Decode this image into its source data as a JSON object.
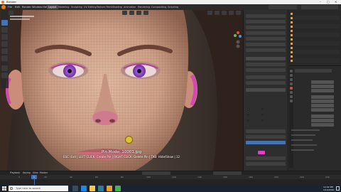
{
  "window": {
    "title": "Blender"
  },
  "menu": {
    "items": [
      "File",
      "Edit",
      "Render",
      "Window",
      "Help"
    ],
    "workspaces": [
      "Layout",
      "Modeling",
      "Sculpting",
      "UV Editing",
      "Texture Paint",
      "Shading",
      "Animation",
      "Rendering",
      "Compositing",
      "Scripting"
    ],
    "active_workspace": "Layout"
  },
  "viewport": {
    "mode_title": "Pin Mode: 10001.jpg",
    "hint": "ESC: Exit | LEFT CLICK: Create Pin | RIGHT CLICK: Delete Pin | TAB: Hide/Show | 12"
  },
  "npanel": {
    "colors": {
      "accent": "#4772b3",
      "magenta": "#e040c8"
    }
  },
  "timeline": {
    "menu": [
      "Playback",
      "Keying",
      "View",
      "Marker"
    ],
    "current_frame": "1",
    "ticks": [
      "0",
      "20",
      "40",
      "60",
      "80",
      "100",
      "120",
      "140",
      "160",
      "180",
      "200",
      "220",
      "240"
    ]
  },
  "taskbar": {
    "search_placeholder": "Type here to search",
    "time": "12:02 PM",
    "date": "1/10/2020"
  },
  "colors": {
    "accent": "#4772b3",
    "outliner_icon": "#e8a035"
  }
}
